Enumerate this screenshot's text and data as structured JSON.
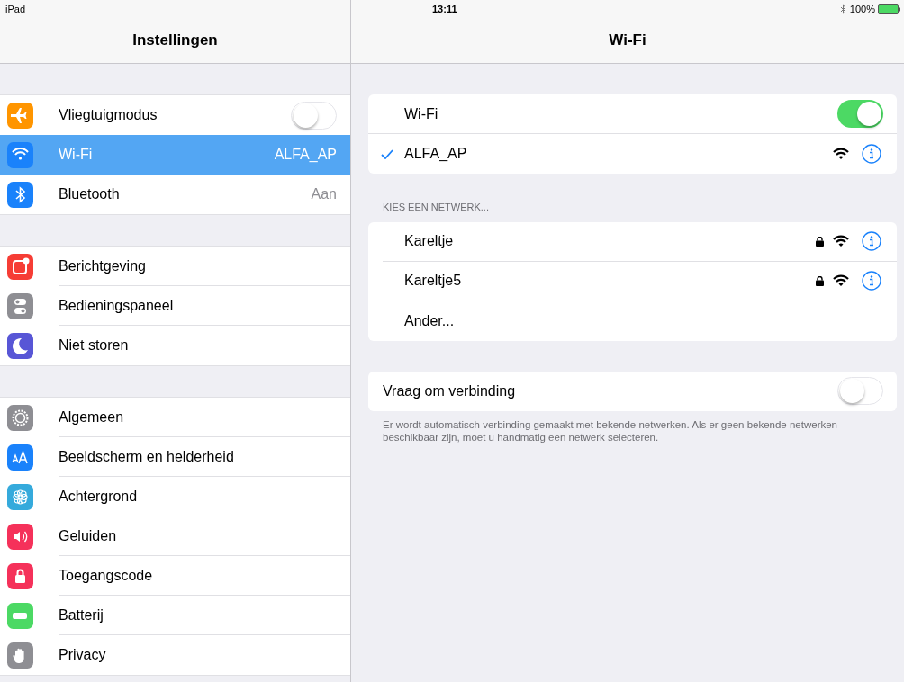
{
  "status_bar": {
    "device": "iPad",
    "time": "13:11",
    "battery": "100%"
  },
  "sidebar": {
    "title": "Instellingen",
    "groups": [
      [
        {
          "label": "Vliegtuigmodus",
          "kind": "toggle",
          "on": false,
          "selected": false,
          "color": "#ff9500"
        },
        {
          "label": "Wi-Fi",
          "kind": "value",
          "value": "ALFA_AP",
          "selected": true,
          "color": "#1a82fb"
        },
        {
          "label": "Bluetooth",
          "kind": "value",
          "value": "Aan",
          "selected": false,
          "color": "#1a82fb"
        }
      ],
      [
        {
          "label": "Berichtgeving",
          "kind": "plain",
          "selected": false,
          "color": "#f63d35"
        },
        {
          "label": "Bedieningspaneel",
          "kind": "plain",
          "selected": false,
          "color": "#8e8e93"
        },
        {
          "label": "Niet storen",
          "kind": "plain",
          "selected": false,
          "color": "#5856d6"
        }
      ],
      [
        {
          "label": "Algemeen",
          "kind": "plain",
          "selected": false,
          "color": "#8e8e93"
        },
        {
          "label": "Beeldscherm en helderheid",
          "kind": "plain",
          "selected": false,
          "color": "#1a82fb"
        },
        {
          "label": "Achtergrond",
          "kind": "plain",
          "selected": false,
          "color": "#35aadc"
        },
        {
          "label": "Geluiden",
          "kind": "plain",
          "selected": false,
          "color": "#f5315a"
        },
        {
          "label": "Toegangscode",
          "kind": "plain",
          "selected": false,
          "color": "#f5315a"
        },
        {
          "label": "Batterij",
          "kind": "plain",
          "selected": false,
          "color": "#4cd964"
        },
        {
          "label": "Privacy",
          "kind": "plain",
          "selected": false,
          "color": "#8e8e93"
        }
      ]
    ]
  },
  "detail": {
    "title": "Wi-Fi",
    "wifi": {
      "label": "Wi-Fi",
      "on": true
    },
    "connected": {
      "name": "ALFA_AP",
      "selected": true
    },
    "section_header": "KIES EEN NETWERK...",
    "networks": [
      {
        "name": "Kareltje",
        "kind": "network",
        "secured": true
      },
      {
        "name": "Kareltje5",
        "kind": "network",
        "secured": true
      },
      {
        "name": "Ander...",
        "kind": "other"
      }
    ],
    "ask_to_join": {
      "label": "Vraag om verbinding",
      "on": false
    },
    "footnote": "Er wordt automatisch verbinding gemaakt met bekende netwerken. Als er geen bekende netwerken beschikbaar zijn, moet u handmatig een netwerk selecteren."
  }
}
